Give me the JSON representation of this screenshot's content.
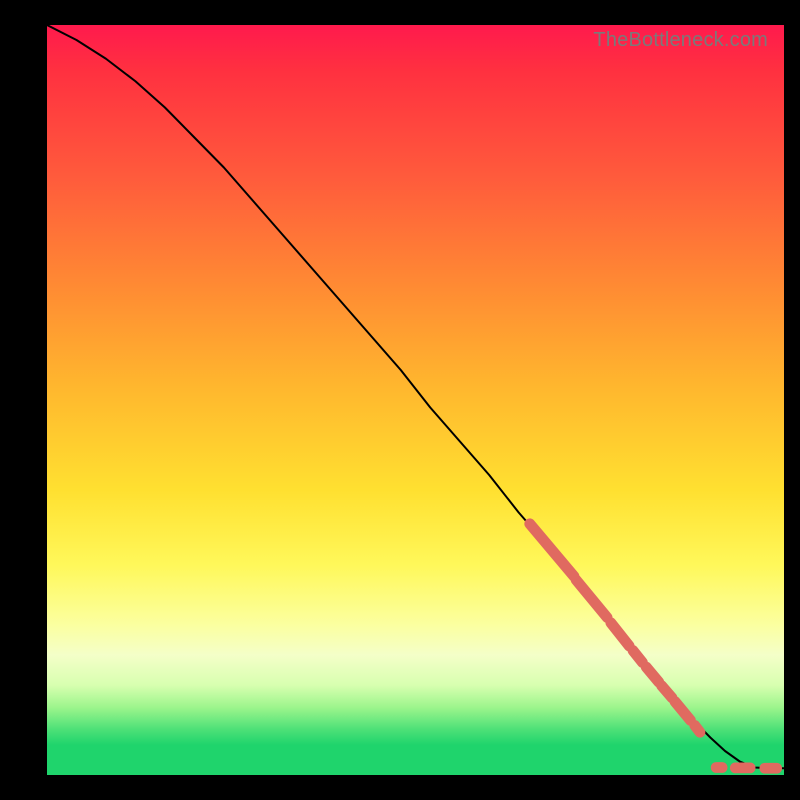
{
  "watermark": "TheBottleneck.com",
  "colors": {
    "curve": "#000000",
    "dots": "#e06a60",
    "dots_stroke": "#d85b52"
  },
  "chart_data": {
    "type": "line",
    "title": "",
    "xlabel": "",
    "ylabel": "",
    "xlim": [
      0,
      100
    ],
    "ylim": [
      0,
      100
    ],
    "series": [
      {
        "name": "curve",
        "x": [
          0,
          4,
          8,
          12,
          16,
          20,
          24,
          28,
          32,
          36,
          40,
          44,
          48,
          52,
          56,
          60,
          64,
          68,
          72,
          76,
          80,
          84,
          88,
          90,
          92,
          94,
          96,
          98,
          100
        ],
        "y": [
          100,
          98,
          95.5,
          92.5,
          89,
          85,
          81,
          76.5,
          72,
          67.5,
          63,
          58.5,
          54,
          49,
          44.5,
          40,
          35,
          30.5,
          26,
          21,
          16.5,
          12,
          7,
          5,
          3.2,
          1.8,
          1.0,
          0.9,
          0.9
        ]
      }
    ],
    "dot_segments": [
      {
        "x0": 65.5,
        "y0": 33.5,
        "x1": 71.5,
        "y1": 26.5
      },
      {
        "x0": 71.8,
        "y0": 26.0,
        "x1": 76.0,
        "y1": 21.0
      },
      {
        "x0": 76.5,
        "y0": 20.3,
        "x1": 79.0,
        "y1": 17.2
      },
      {
        "x0": 79.5,
        "y0": 16.6,
        "x1": 80.8,
        "y1": 15.0
      },
      {
        "x0": 81.3,
        "y0": 14.4,
        "x1": 83.0,
        "y1": 12.4
      },
      {
        "x0": 83.4,
        "y0": 11.9,
        "x1": 84.8,
        "y1": 10.3
      },
      {
        "x0": 85.2,
        "y0": 9.8,
        "x1": 87.3,
        "y1": 7.3
      },
      {
        "x0": 87.9,
        "y0": 6.6,
        "x1": 88.6,
        "y1": 5.7
      },
      {
        "x0": 90.8,
        "y0": 1.0,
        "x1": 91.6,
        "y1": 1.0
      },
      {
        "x0": 93.4,
        "y0": 0.95,
        "x1": 95.4,
        "y1": 0.95
      },
      {
        "x0": 97.4,
        "y0": 0.9,
        "x1": 99.0,
        "y1": 0.9
      }
    ],
    "dot_radius_px": 5.4
  }
}
